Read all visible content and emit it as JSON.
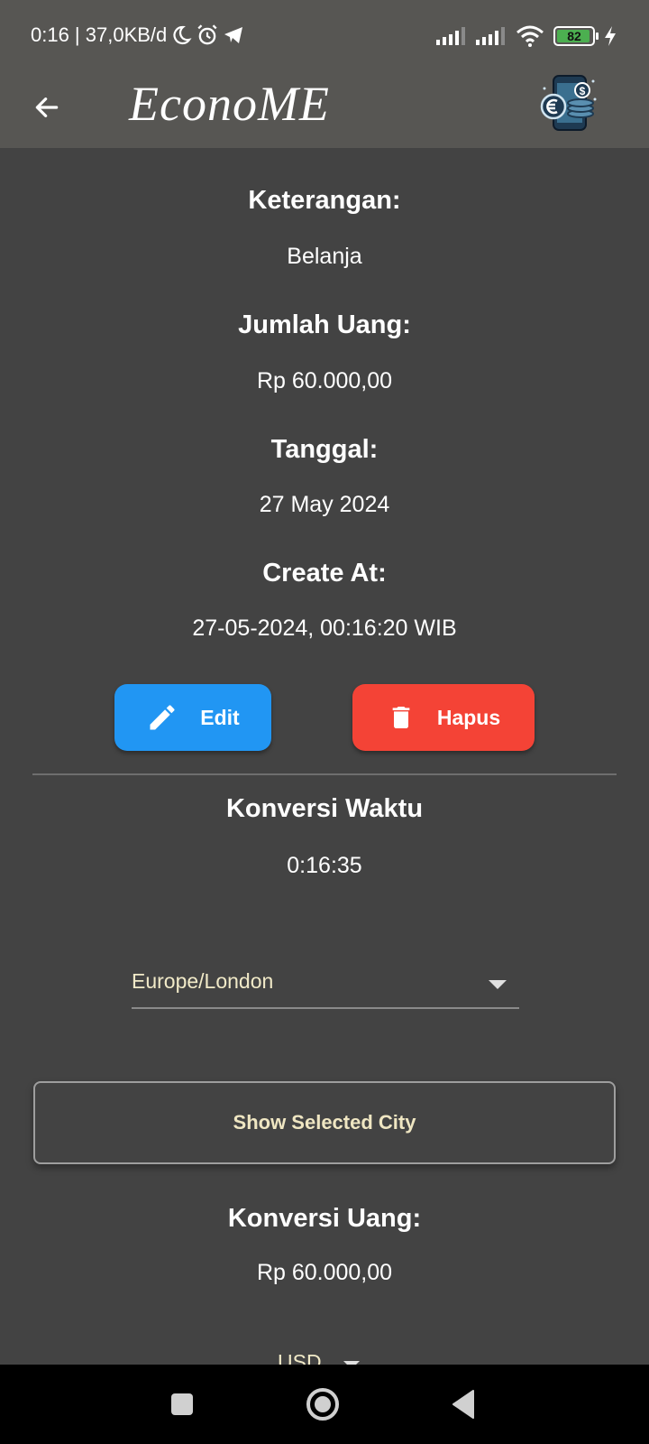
{
  "status_bar": {
    "time_info": "0:16 | 37,0KB/d",
    "battery": "82"
  },
  "app_bar": {
    "title": "EconoME",
    "logo": "money-phone-logo"
  },
  "details": {
    "description_label": "Keterangan:",
    "description_value": "Belanja",
    "amount_label": "Jumlah Uang:",
    "amount_value": "Rp 60.000,00",
    "date_label": "Tanggal:",
    "date_value": "27 May 2024",
    "created_label": "Create At:",
    "created_value": "27-05-2024, 00:16:20 WIB"
  },
  "actions": {
    "edit_label": "Edit",
    "edit_color": "#2196f3",
    "delete_label": "Hapus",
    "delete_color": "#f44336"
  },
  "time_conversion": {
    "title": "Konversi Waktu",
    "time": "0:16:35",
    "timezone_selected": "Europe/London",
    "show_city_label": "Show Selected City"
  },
  "money_conversion": {
    "title": "Konversi Uang:",
    "value": "Rp 60.000,00",
    "currency_selected": "USD"
  },
  "icons": [
    "moon-icon",
    "alarm-icon",
    "telegram-icon",
    "signal-icon",
    "wifi-icon",
    "battery-icon",
    "charging-icon",
    "back-arrow-icon",
    "pencil-icon",
    "trash-icon",
    "square-icon",
    "home-circle-icon",
    "back-triangle-icon"
  ]
}
